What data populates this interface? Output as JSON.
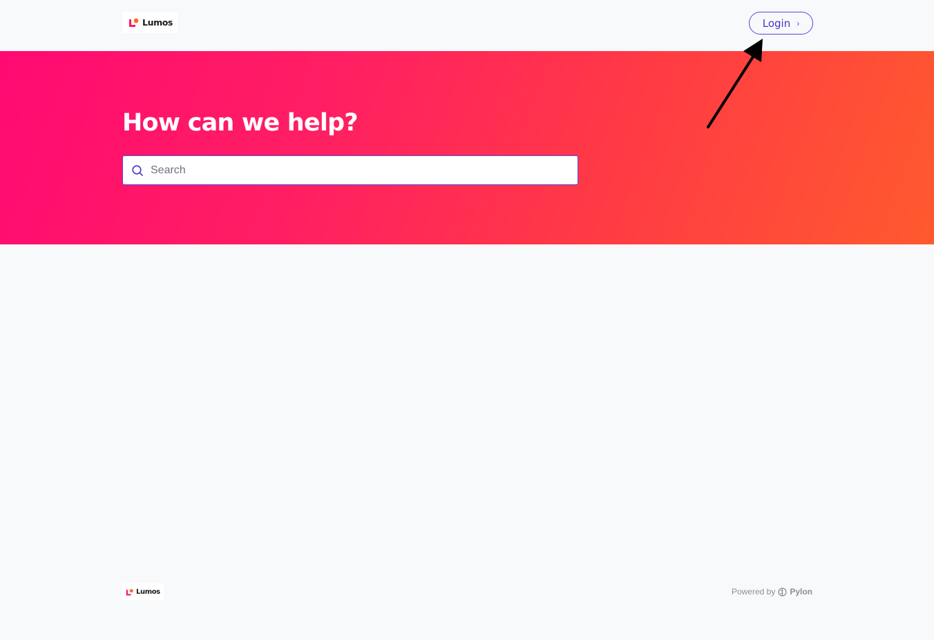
{
  "header": {
    "logo_text": "Lumos",
    "login_label": "Login",
    "login_chevron": "›"
  },
  "hero": {
    "title": "How can we help?",
    "search_placeholder": "Search"
  },
  "footer": {
    "logo_text": "Lumos",
    "powered_by": "Powered by",
    "provider": "Pylon"
  },
  "icons": {
    "logo": "lumos-logo-icon",
    "search": "search-icon",
    "chevron": "chevron-right-icon",
    "provider": "pylon-logo-icon"
  },
  "colors": {
    "accent": "#4f46e5",
    "brand_pink": "#ff0a72",
    "brand_orange": "#ff5a2e",
    "background": "#f8f9fa"
  }
}
